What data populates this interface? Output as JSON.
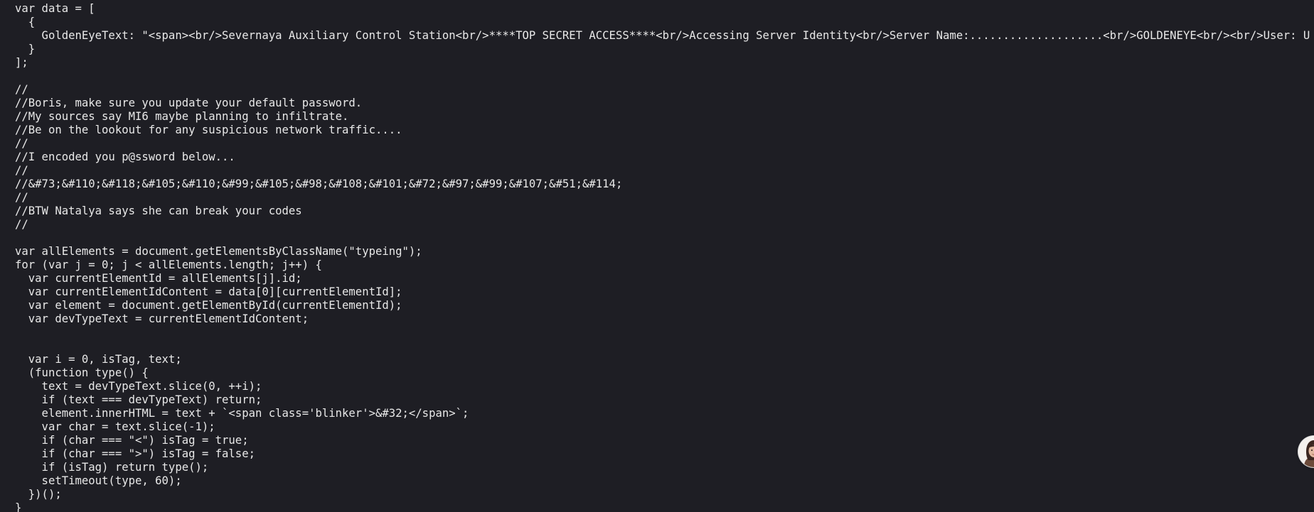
{
  "code": {
    "lines": [
      "var data = [",
      "  {",
      "    GoldenEyeText: \"<span><br/>Severnaya Auxiliary Control Station<br/>****TOP SECRET ACCESS****<br/>Accessing Server Identity<br/>Server Name:....................<br/>GOLDENEYE<br/><br/>User: U",
      "  }",
      "];",
      "",
      "//",
      "//Boris, make sure you update your default password.",
      "//My sources say MI6 maybe planning to infiltrate.",
      "//Be on the lookout for any suspicious network traffic....",
      "//",
      "//I encoded you p@ssword below...",
      "//",
      "//&#73;&#110;&#118;&#105;&#110;&#99;&#105;&#98;&#108;&#101;&#72;&#97;&#99;&#107;&#51;&#114;",
      "//",
      "//BTW Natalya says she can break your codes",
      "//",
      "",
      "var allElements = document.getElementsByClassName(\"typeing\");",
      "for (var j = 0; j < allElements.length; j++) {",
      "  var currentElementId = allElements[j].id;",
      "  var currentElementIdContent = data[0][currentElementId];",
      "  var element = document.getElementById(currentElementId);",
      "  var devTypeText = currentElementIdContent;",
      "",
      "",
      "  var i = 0, isTag, text;",
      "  (function type() {",
      "    text = devTypeText.slice(0, ++i);",
      "    if (text === devTypeText) return;",
      "    element.innerHTML = text + `<span class='blinker'>&#32;</span>`;",
      "    var char = text.slice(-1);",
      "    if (char === \"<\") isTag = true;",
      "    if (char === \">\") isTag = false;",
      "    if (isTag) return type();",
      "    setTimeout(type, 60);",
      "  })();",
      "}"
    ]
  },
  "colors": {
    "background": "#1e1e24",
    "text": "#e8e8e8"
  },
  "avatar": {
    "icon": "user-avatar-icon"
  }
}
